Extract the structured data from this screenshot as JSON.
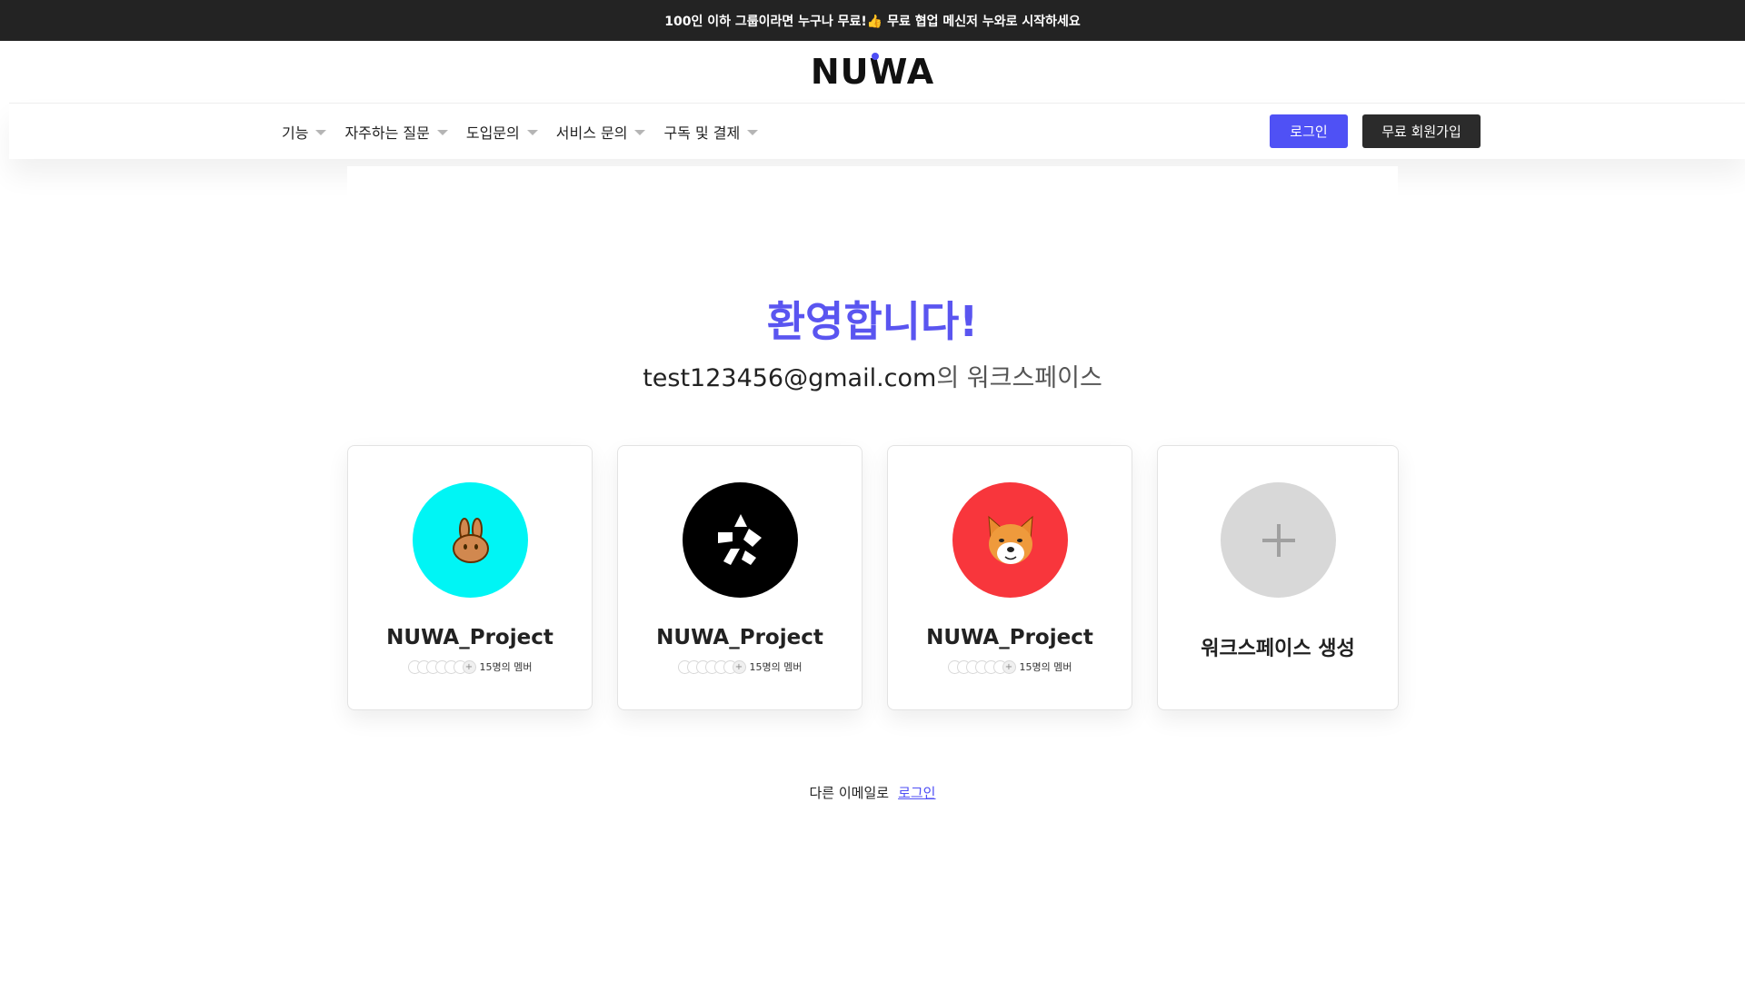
{
  "announcement": "100인 이하 그룹이라면 누구나 무료!👍 무료 협업 메신저 누와로 시작하세요",
  "logo": {
    "text_a": "NU",
    "text_b": "WA"
  },
  "nav": {
    "items": [
      {
        "label": "기능"
      },
      {
        "label": "자주하는 질문"
      },
      {
        "label": "도입문의"
      },
      {
        "label": "서비스 문의"
      },
      {
        "label": "구독 및 결제"
      }
    ],
    "login_label": "로그인",
    "signup_label": "무료 회원가입"
  },
  "welcome": {
    "title": "환영합니다!",
    "email": "test123456@gmail.com",
    "suffix": "의 워크스페이스"
  },
  "workspaces": [
    {
      "name": "NUWA_Project",
      "members": "15명의 멤버",
      "icon": "pancake-bunny-icon",
      "color": "#00f5f5"
    },
    {
      "name": "NUWA_Project",
      "members": "15명의 멤버",
      "icon": "quant-logo-icon",
      "color": "#000000"
    },
    {
      "name": "NUWA_Project",
      "members": "15명의 멤버",
      "icon": "shiba-inu-icon",
      "color": "#f8363c"
    }
  ],
  "create_workspace": {
    "label": "워크스페이스 생성",
    "icon": "plus-icon",
    "color": "#d8d8d8"
  },
  "footer": {
    "other_email": "다른 이메일로",
    "login_link": "로그인"
  }
}
